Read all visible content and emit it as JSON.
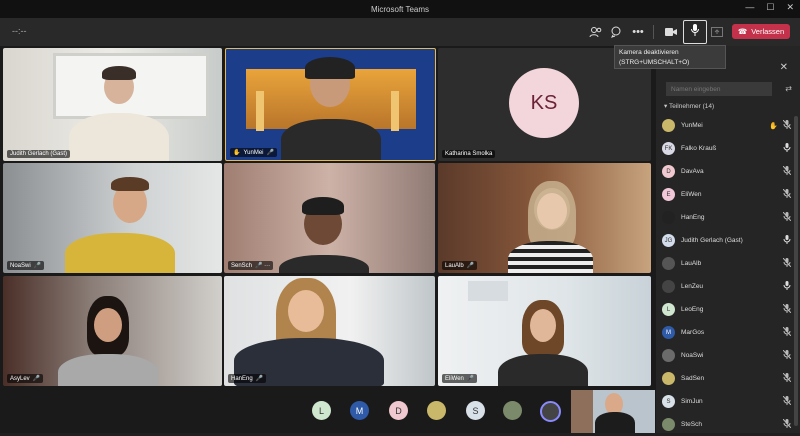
{
  "app": {
    "title": "Microsoft Teams"
  },
  "window_buttons": [
    "—",
    "☐",
    "✕"
  ],
  "toolbar": {
    "timer": "--:--",
    "leave_label": "Verlassen",
    "tooltip_line1": "Kamera deaktivieren",
    "tooltip_line2": "(STRG+UMSCHALT+O)"
  },
  "icons": {
    "participants": "people-icon",
    "chat": "chat-icon",
    "more": "more-icon",
    "camera": "camera-icon",
    "mic": "microphone-icon",
    "share": "share-icon",
    "phone": "phone-icon"
  },
  "colors": {
    "accent": "#c4314b",
    "tile_border_active": "#e7b84a"
  },
  "tiles": [
    {
      "name": "Judith Gerlach (Gast)",
      "mic": "",
      "hand": false
    },
    {
      "name": "YunMei",
      "mic": "🎤",
      "hand": true
    },
    {
      "name": "Katharina Smolka",
      "mic": "",
      "hand": false,
      "initials": "KS"
    },
    {
      "name": "NoaSwi",
      "mic": "🎤",
      "hand": false
    },
    {
      "name": "SenSch",
      "mic": "🎤 ···",
      "hand": false
    },
    {
      "name": "LauAlb",
      "mic": "🎤",
      "hand": false
    },
    {
      "name": "AsyLev",
      "mic": "🎤",
      "hand": false
    },
    {
      "name": "HanEng",
      "mic": "🎤",
      "hand": false
    },
    {
      "name": "EliWen",
      "mic": "🎤",
      "hand": false
    }
  ],
  "panel": {
    "search_placeholder": "Namen eingeben",
    "section_label": "Teilnehmer (14)",
    "participants": [
      {
        "name": "YunMei",
        "avatar": "",
        "color": "#c9b86a",
        "hand": true,
        "muted": true
      },
      {
        "name": "Falko Krauß",
        "avatar": "FK",
        "color": "#d9d9e6",
        "hand": false,
        "muted": false
      },
      {
        "name": "DavAva",
        "avatar": "D",
        "color": "#f0c8cf",
        "hand": false,
        "muted": true
      },
      {
        "name": "EliWen",
        "avatar": "E",
        "color": "#f0c8d8",
        "hand": false,
        "muted": true
      },
      {
        "name": "HanEng",
        "avatar": "",
        "color": "#222222",
        "hand": false,
        "muted": true
      },
      {
        "name": "Judith Gerlach (Gast)",
        "avatar": "JG",
        "color": "#d3dcea",
        "hand": false,
        "muted": false
      },
      {
        "name": "LauAlb",
        "avatar": "",
        "color": "#555555",
        "hand": false,
        "muted": true
      },
      {
        "name": "LenZeu",
        "avatar": "",
        "color": "#444444",
        "hand": false,
        "muted": false
      },
      {
        "name": "LeoEng",
        "avatar": "L",
        "color": "#cfe6cf",
        "hand": false,
        "muted": true
      },
      {
        "name": "MarGos",
        "avatar": "M",
        "color": "#2f5aa8",
        "hand": false,
        "muted": true
      },
      {
        "name": "NoaSwi",
        "avatar": "",
        "color": "#6b6b6b",
        "hand": false,
        "muted": true
      },
      {
        "name": "SadSen",
        "avatar": "",
        "color": "#c9b86a",
        "hand": false,
        "muted": true
      },
      {
        "name": "SimJun",
        "avatar": "S",
        "color": "#d8e0e8",
        "hand": false,
        "muted": true
      },
      {
        "name": "SteSch",
        "avatar": "",
        "color": "#7a8a6a",
        "hand": false,
        "muted": true
      }
    ]
  },
  "bottom_avatars": [
    {
      "initial": "L",
      "color": "#cfe6cf"
    },
    {
      "initial": "M",
      "color": "#2f5aa8"
    },
    {
      "initial": "D",
      "color": "#f0c8cf"
    },
    {
      "initial": "",
      "color": "#c9b86a"
    },
    {
      "initial": "S",
      "color": "#d8e0e8"
    },
    {
      "initial": "",
      "color": "#7a8a6a"
    },
    {
      "initial": "",
      "color": "#444444"
    }
  ]
}
